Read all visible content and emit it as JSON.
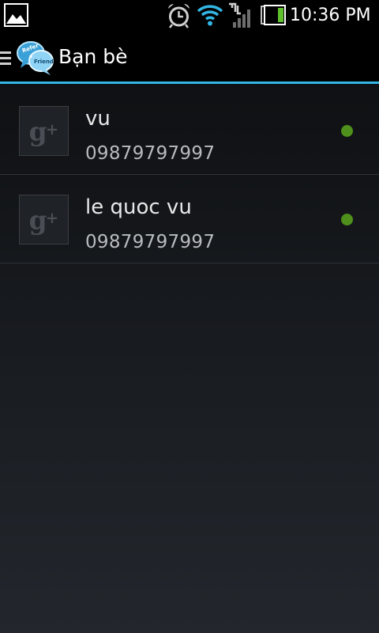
{
  "status_bar": {
    "time": "10:36 PM",
    "icons": [
      "gallery-icon",
      "alarm-icon",
      "wifi-icon",
      "signal-icon",
      "battery-icon"
    ]
  },
  "action_bar": {
    "title": "Bạn bè",
    "logo_text": [
      "Refer",
      "a",
      "Friend"
    ],
    "icons": [
      "menu-icon",
      "app-logo-icon"
    ],
    "accent_color": "#33b5e5"
  },
  "friends": [
    {
      "name": "vu",
      "phone": "09879797997",
      "avatar_icon": "google-plus-icon",
      "online_color": "#4f8f1c"
    },
    {
      "name": "le quoc vu",
      "phone": "09879797997",
      "avatar_icon": "google-plus-icon",
      "online_color": "#4f8f1c"
    }
  ]
}
